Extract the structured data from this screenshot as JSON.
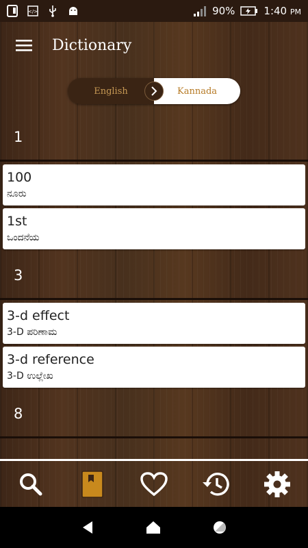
{
  "status": {
    "battery": "90%",
    "time": "1:40",
    "ampm": "PM"
  },
  "app_bar": {
    "title": "Dictionary"
  },
  "toggle": {
    "left_label": "English",
    "right_label": "Kannada"
  },
  "sections": [
    {
      "header": "1",
      "entries": [
        {
          "word": "100",
          "meaning": "ನೂರು"
        },
        {
          "word": "1st",
          "meaning": "ಒಂದನೆಯ"
        }
      ]
    },
    {
      "header": "3",
      "entries": [
        {
          "word": "3-d effect",
          "meaning": "3-D ಪರಿಣಾಮ"
        },
        {
          "word": "3-d reference",
          "meaning": "3-D ಉಲ್ಲೇಖ"
        }
      ]
    },
    {
      "header": "8",
      "entries": []
    }
  ],
  "bottom_nav": {
    "items": [
      "search-icon",
      "bookmark-icon",
      "heart-icon",
      "history-icon",
      "gear-icon"
    ],
    "active_color": "#c8891d"
  },
  "colors": {
    "accent": "#c8891d",
    "toggle_text_left": "#c89a55",
    "toggle_text_right": "#b67a25"
  }
}
